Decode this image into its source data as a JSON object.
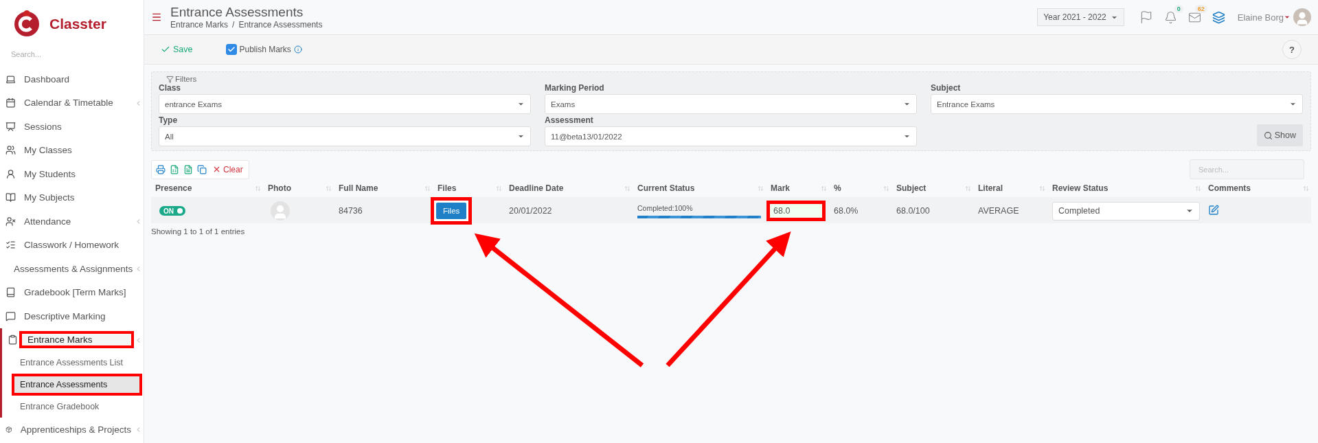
{
  "brand": "Classter",
  "sidebar": {
    "search_placeholder": "Search...",
    "items": [
      {
        "label": "Dashboard",
        "expandable": false,
        "selected": false,
        "highlighted": false
      },
      {
        "label": "Calendar & Timetable",
        "expandable": true,
        "selected": false,
        "highlighted": false
      },
      {
        "label": "Sessions",
        "expandable": false,
        "selected": false,
        "highlighted": false
      },
      {
        "label": "My Classes",
        "expandable": false,
        "selected": false,
        "highlighted": false
      },
      {
        "label": "My Students",
        "expandable": false,
        "selected": false,
        "highlighted": false
      },
      {
        "label": "My Subjects",
        "expandable": false,
        "selected": false,
        "highlighted": false
      },
      {
        "label": "Attendance",
        "expandable": true,
        "selected": false,
        "highlighted": false
      },
      {
        "label": "Classwork / Homework",
        "expandable": false,
        "selected": false,
        "highlighted": false
      },
      {
        "label": "Assessments & Assignments",
        "expandable": true,
        "selected": false,
        "highlighted": false
      },
      {
        "label": "Gradebook [Term Marks]",
        "expandable": false,
        "selected": false,
        "highlighted": false
      },
      {
        "label": "Descriptive Marking",
        "expandable": false,
        "selected": false,
        "highlighted": false
      },
      {
        "label": "Entrance Marks",
        "expandable": true,
        "selected": true,
        "highlighted": true,
        "children": [
          {
            "label": "Entrance Assessments List",
            "selected": false,
            "highlighted": false
          },
          {
            "label": "Entrance Assessments",
            "selected": true,
            "highlighted": true
          },
          {
            "label": "Entrance Gradebook",
            "selected": false,
            "highlighted": false
          }
        ]
      },
      {
        "label": "Apprenticeships & Projects",
        "expandable": true,
        "selected": false,
        "highlighted": false
      }
    ]
  },
  "header": {
    "title": "Entrance Assessments",
    "breadcrumbs": [
      "Entrance Marks",
      "Entrance Assessments"
    ],
    "breadcrumb_separator": "/",
    "year": "Year 2021 - 2022",
    "notifications": "0",
    "messages": "62",
    "user": "Elaine Borg"
  },
  "toolbar": {
    "save": "Save",
    "publish": {
      "label": "Publish Marks",
      "checked": true
    },
    "help": "?"
  },
  "filters": {
    "legend": "Filters",
    "fields": [
      {
        "label": "Class",
        "value": "entrance Exams"
      },
      {
        "label": "Marking Period",
        "value": "Exams"
      },
      {
        "label": "Subject",
        "value": "Entrance Exams"
      },
      {
        "label": "Type",
        "value": "All"
      },
      {
        "label": "Assessment",
        "value": "11@beta13/01/2022"
      }
    ],
    "show_button": "Show"
  },
  "table": {
    "actions": [
      {
        "kind": "print"
      },
      {
        "kind": "excel"
      },
      {
        "kind": "csv"
      },
      {
        "kind": "copy"
      },
      {
        "kind": "clear",
        "label": "Clear"
      }
    ],
    "search_placeholder": "Search...",
    "columns": [
      "Presence",
      "Photo",
      "Full Name",
      "Files",
      "Deadline Date",
      "Current Status",
      "Mark",
      "%",
      "Subject",
      "Literal",
      "Review Status",
      "Comments"
    ],
    "rows": [
      {
        "cells": [
          {
            "kind": "toggle",
            "label": "ON",
            "on": true
          },
          {
            "kind": "photo"
          },
          {
            "kind": "text",
            "text": "84736"
          },
          {
            "kind": "button",
            "label": "Files",
            "highlighted": true
          },
          {
            "kind": "text",
            "text": "20/01/2022"
          },
          {
            "kind": "progress",
            "text": "Completed:100%",
            "level": 1
          },
          {
            "kind": "input",
            "value": "68.0",
            "highlighted": true
          },
          {
            "kind": "text",
            "text": "68.0%"
          },
          {
            "kind": "text",
            "text": "68.0/100"
          },
          {
            "kind": "text",
            "text": "AVERAGE"
          },
          {
            "kind": "select",
            "value": "Completed"
          },
          {
            "kind": "edit"
          }
        ]
      }
    ],
    "info": "Showing 1 to 1 of 1 entries"
  }
}
